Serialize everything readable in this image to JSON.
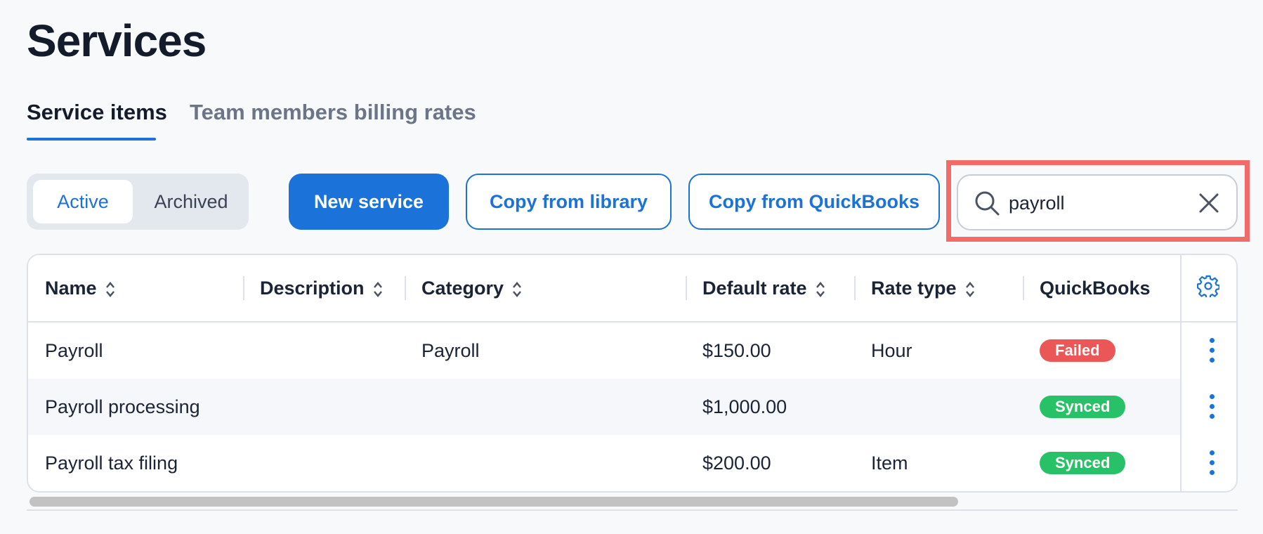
{
  "page": {
    "title": "Services"
  },
  "tabs": [
    {
      "label": "Service items",
      "active": true
    },
    {
      "label": "Team members billing rates",
      "active": false
    }
  ],
  "status_filter": {
    "options": [
      "Active",
      "Archived"
    ],
    "selected": "Active"
  },
  "actions": {
    "new_service": "New service",
    "copy_library": "Copy from library",
    "copy_quickbooks": "Copy from QuickBooks"
  },
  "search": {
    "value": "payroll",
    "icon": "search-icon",
    "clear_icon": "close-icon"
  },
  "table": {
    "columns": [
      "Name",
      "Description",
      "Category",
      "Default rate",
      "Rate type",
      "QuickBooks"
    ],
    "settings_icon": "gear-icon",
    "rows": [
      {
        "name": "Payroll",
        "description": "",
        "category": "Payroll",
        "default_rate": "$150.00",
        "rate_type": "Hour",
        "quickbooks": "Failed"
      },
      {
        "name": "Payroll processing",
        "description": "",
        "category": "",
        "default_rate": "$1,000.00",
        "rate_type": "",
        "quickbooks": "Synced"
      },
      {
        "name": "Payroll tax filing",
        "description": "",
        "category": "",
        "default_rate": "$200.00",
        "rate_type": "Item",
        "quickbooks": "Synced"
      }
    ]
  },
  "colors": {
    "accent": "#1b72d8",
    "failed": "#eb5757",
    "synced": "#27c267",
    "highlight": "#f26a6a"
  }
}
